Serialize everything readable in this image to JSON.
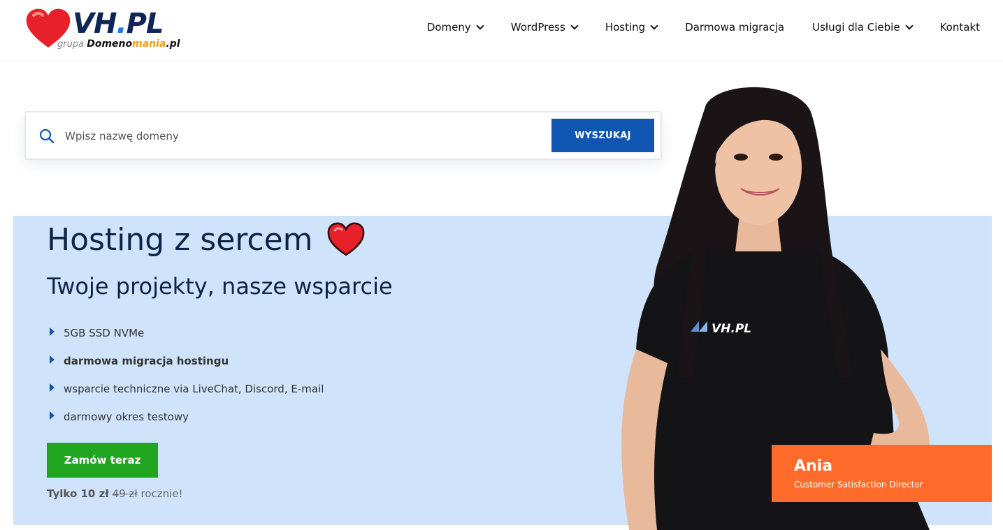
{
  "brand": {
    "logo_main": "VH",
    "logo_dot": ".",
    "logo_end": "PL",
    "logo_group": "grupa",
    "logo_domeno": "Domeno",
    "logo_mania": "mania",
    "logo_tld": ".pl"
  },
  "nav": {
    "items": [
      {
        "label": "Domeny",
        "dropdown": true
      },
      {
        "label": "WordPress",
        "dropdown": true
      },
      {
        "label": "Hosting",
        "dropdown": true
      },
      {
        "label": "Darmowa migracja",
        "dropdown": false
      },
      {
        "label": "Usługi dla Ciebie",
        "dropdown": true
      },
      {
        "label": "Kontakt",
        "dropdown": false
      }
    ]
  },
  "search": {
    "placeholder": "Wpisz nazwę domeny",
    "value": "",
    "button_label": "WYSZUKAJ"
  },
  "hero": {
    "title": "Hosting z sercem",
    "subtitle": "Twoje projekty, nasze wsparcie",
    "features": [
      {
        "text": "5GB SSD NVMe",
        "bold": false
      },
      {
        "text": "darmowa migracja hostingu",
        "bold": true
      },
      {
        "text": "wsparcie techniczne via LiveChat, Discord, E-mail",
        "bold": false
      },
      {
        "text": "darmowy okres testowy",
        "bold": false
      }
    ],
    "order_button": "Zamów teraz",
    "price_prefix": "Tylko 10 zł",
    "price_old": "49 zł",
    "price_suffix": "rocznie!"
  },
  "person": {
    "name": "Ania",
    "role": "Customer Satisfaction Director",
    "shirt_logo": "VH.PL"
  },
  "colors": {
    "primary_blue": "#0f56b3",
    "navy_text": "#0c2446",
    "hero_bg": "#cfe4fb",
    "cta_green": "#1fa520",
    "card_orange": "#ff6b2b",
    "heart_red": "#e8202a"
  }
}
